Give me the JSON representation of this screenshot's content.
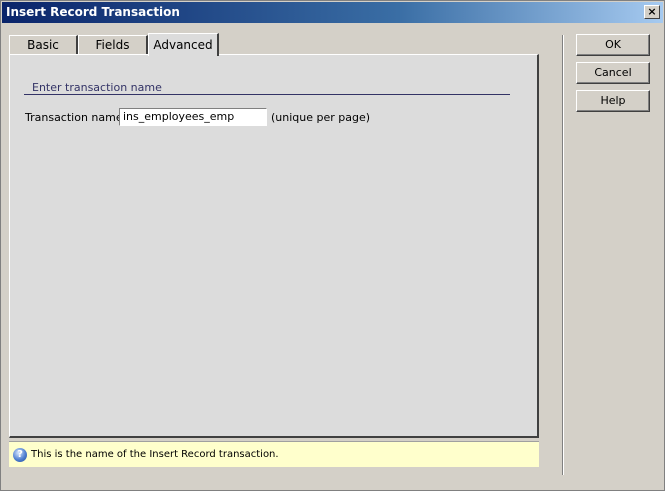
{
  "window": {
    "title": "Insert Record Transaction",
    "close_glyph": "×"
  },
  "tabs": [
    {
      "label": "Basic",
      "active": false
    },
    {
      "label": "Fields",
      "active": false
    },
    {
      "label": "Advanced",
      "active": true
    }
  ],
  "panel": {
    "section_title": "Enter transaction name",
    "transaction_label": "Transaction name:",
    "transaction_value": "ins_employees_emp",
    "transaction_hint": "(unique per page)"
  },
  "help": {
    "icon": "help-icon",
    "icon_glyph": "?",
    "text": "This is the name of the Insert Record transaction."
  },
  "buttons": {
    "ok": "OK",
    "cancel": "Cancel",
    "help": "Help"
  }
}
